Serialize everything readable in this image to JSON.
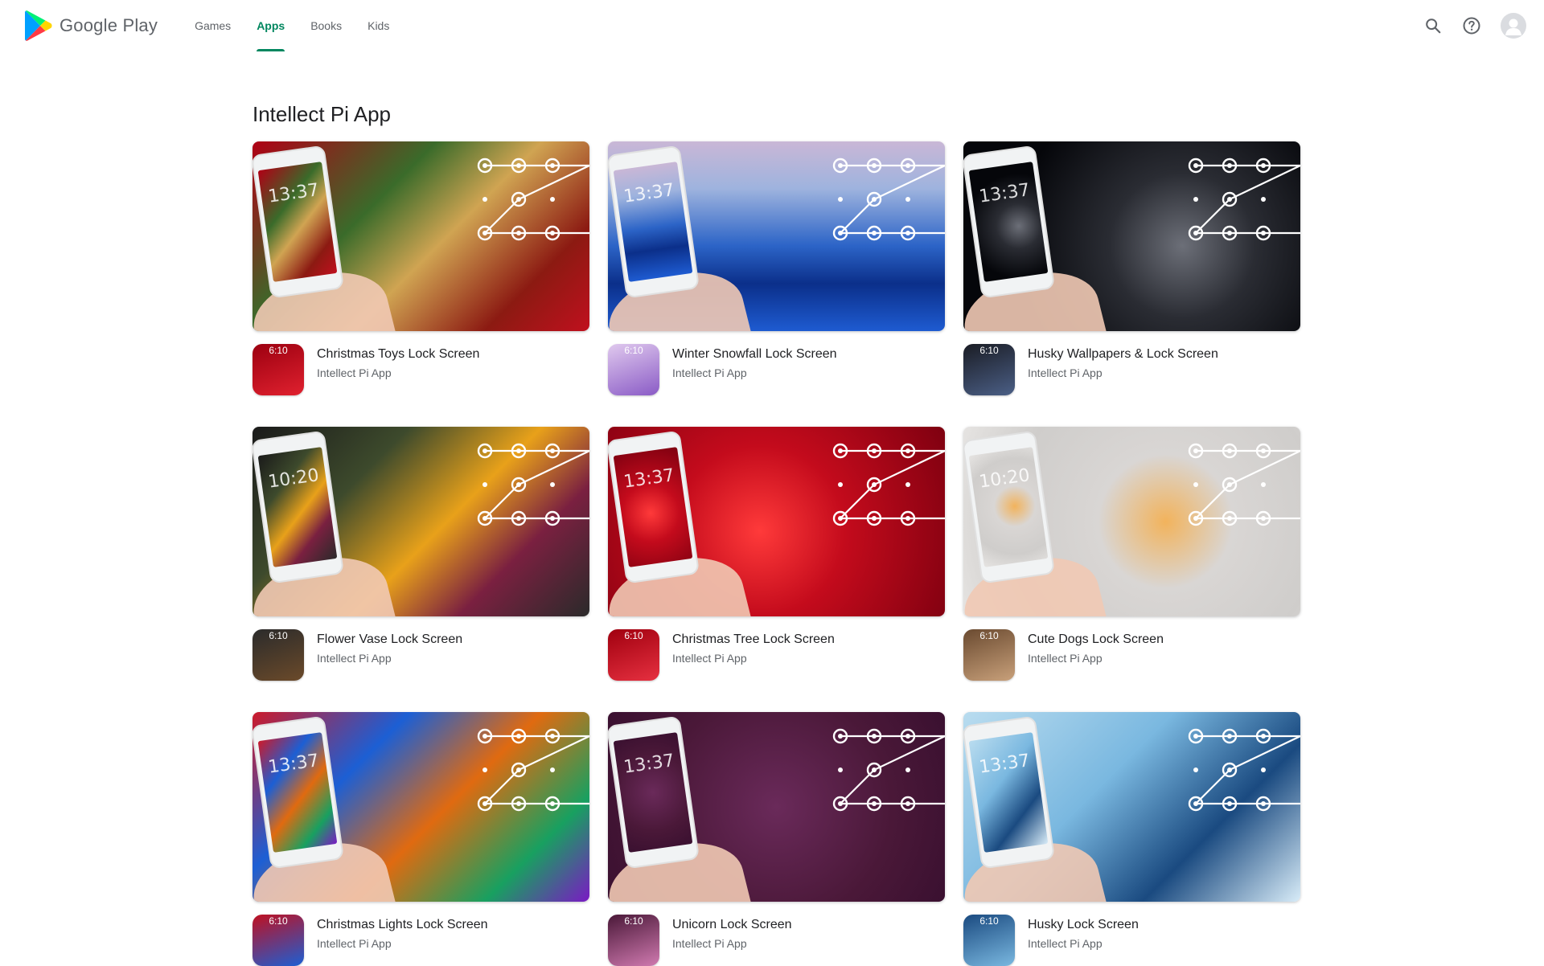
{
  "header": {
    "logo_text": "Google Play",
    "tabs": [
      {
        "label": "Games",
        "active": false
      },
      {
        "label": "Apps",
        "active": true
      },
      {
        "label": "Books",
        "active": false
      },
      {
        "label": "Kids",
        "active": false
      }
    ],
    "icons": [
      "search-icon",
      "help-icon",
      "account-avatar"
    ]
  },
  "colors": {
    "accent": "#01875f",
    "text_primary": "#202124",
    "text_secondary": "#5f6368"
  },
  "developer": {
    "title": "Intellect Pi App"
  },
  "apps": [
    {
      "name": "Christmas Toys Lock Screen",
      "developer": "Intellect Pi App",
      "banner_time": "13:37",
      "icon_time": "6:10",
      "bg": "linear-gradient(135deg,#b00015 0%,#3a6b2a 35%,#d0a452 55%,#8c1a12 80%,#c0101e 100%)",
      "icon_bg": "linear-gradient(160deg,#9c0010,#e0212f)"
    },
    {
      "name": "Winter Snowfall Lock Screen",
      "developer": "Intellect Pi App",
      "banner_time": "13:37",
      "icon_time": "6:10",
      "bg": "linear-gradient(180deg,#c9b7d6 0%,#9eb3de 25%,#2c64c7 55%,#0b2f8a 75%,#1e5bd1 100%)",
      "icon_bg": "linear-gradient(160deg,#e0c9ee,#8a5bc6)"
    },
    {
      "name": "Husky Wallpapers & Lock Screen",
      "developer": "Intellect Pi App",
      "banner_time": "13:37",
      "icon_time": "6:10",
      "bg": "radial-gradient(circle at 65% 55%,#6c6f78 0%,#2a2c33 30%,#05060a 70%)",
      "icon_bg": "linear-gradient(160deg,#1a1c24,#4b5f86)"
    },
    {
      "name": "Flower Vase Lock Screen",
      "developer": "Intellect Pi App",
      "banner_time": "10:20",
      "icon_time": "6:10",
      "bg": "linear-gradient(135deg,#1a1a1a 0%,#3d4a2c 30%,#e8a11a 55%,#7a2040 75%,#2a2a2a 100%)",
      "icon_bg": "linear-gradient(160deg,#2b2b2b,#6b4a2a)"
    },
    {
      "name": "Christmas Tree Lock Screen",
      "developer": "Intellect Pi App",
      "banner_time": "13:37",
      "icon_time": "6:10",
      "bg": "radial-gradient(circle at 45% 55%,#ff3a3a 0%,#c40b1c 40%,#7e0010 100%)",
      "icon_bg": "linear-gradient(160deg,#a0000f,#e63040)"
    },
    {
      "name": "Cute Dogs Lock Screen",
      "developer": "Intellect Pi App",
      "banner_time": "10:20",
      "icon_time": "6:10",
      "bg": "radial-gradient(circle at 60% 50%,#f2b35c 0%,#d9d6d4 30%,#cfcdcb 70%,#e6e4e2 100%)",
      "icon_bg": "linear-gradient(160deg,#6a4a30,#c8a07a)"
    },
    {
      "name": "Christmas Lights Lock Screen",
      "developer": "Intellect Pi App",
      "banner_time": "13:37",
      "icon_time": "6:10",
      "bg": "linear-gradient(135deg,#cc1a2a 0%,#1c5fd4 30%,#e06a10 55%,#18a060 80%,#7a1ac4 100%)",
      "icon_bg": "linear-gradient(160deg,#c01020,#1c5fd4)"
    },
    {
      "name": "Unicorn Lock Screen",
      "developer": "Intellect Pi App",
      "banner_time": "13:37",
      "icon_time": "6:10",
      "bg": "radial-gradient(circle at 50% 50%,#6a2a5a 0%,#4a1838 60%,#3a1030 100%)",
      "icon_bg": "linear-gradient(160deg,#4a1838,#d07ab0)"
    },
    {
      "name": "Husky Lock Screen",
      "developer": "Intellect Pi App",
      "banner_time": "13:37",
      "icon_time": "6:10",
      "bg": "linear-gradient(135deg,#b9dcef 0%,#7ab8e0 40%,#1a4a80 70%,#d8ecf8 100%)",
      "icon_bg": "linear-gradient(160deg,#1a4a80,#7ab8e0)"
    }
  ]
}
